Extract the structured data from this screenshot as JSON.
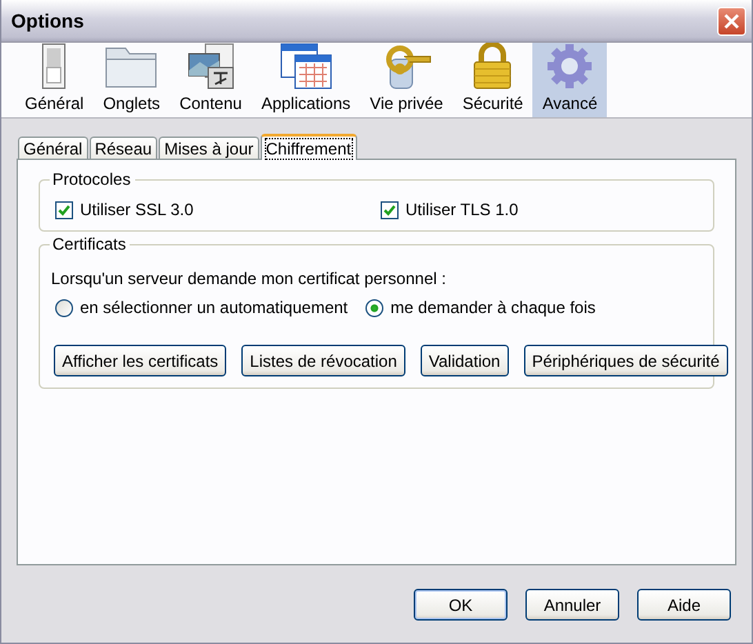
{
  "window": {
    "title": "Options"
  },
  "panes": [
    {
      "label": "Général",
      "kind": "switch",
      "selected": false
    },
    {
      "label": "Onglets",
      "kind": "folder",
      "selected": false
    },
    {
      "label": "Contenu",
      "kind": "content",
      "selected": false
    },
    {
      "label": "Applications",
      "kind": "windows",
      "selected": false
    },
    {
      "label": "Vie privée",
      "kind": "key",
      "selected": false
    },
    {
      "label": "Sécurité",
      "kind": "lock",
      "selected": false
    },
    {
      "label": "Avancé",
      "kind": "gear",
      "selected": true
    }
  ],
  "tabs": [
    {
      "label": "Général",
      "selected": false
    },
    {
      "label": "Réseau",
      "selected": false
    },
    {
      "label": "Mises à jour",
      "selected": false
    },
    {
      "label": "Chiffrement",
      "selected": true
    }
  ],
  "protocols": {
    "title": "Protocoles",
    "options": [
      {
        "label": "Utiliser SSL 3.0",
        "checked": true
      },
      {
        "label": "Utiliser TLS 1.0",
        "checked": true
      }
    ]
  },
  "certificates": {
    "title": "Certificats",
    "prompt": "Lorsqu'un serveur demande mon certificat personnel :",
    "choices": [
      {
        "label": "en sélectionner un automatiquement",
        "selected": false
      },
      {
        "label": "me demander à chaque fois",
        "selected": true
      }
    ],
    "buttons": [
      "Afficher les certificats",
      "Listes de révocation",
      "Validation",
      "Périphériques de sécurité"
    ]
  },
  "buttons": [
    "OK",
    "Annuler",
    "Aide"
  ]
}
